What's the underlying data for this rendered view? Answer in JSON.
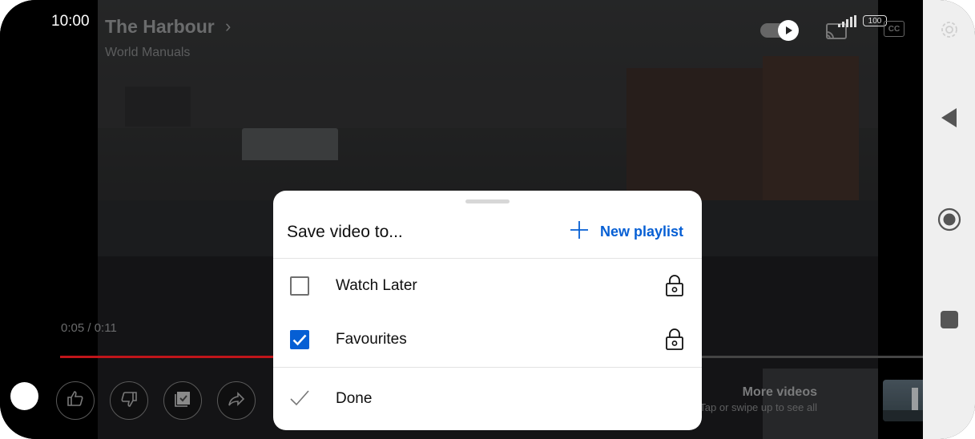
{
  "status_bar": {
    "time": "10:00",
    "battery": "100"
  },
  "video": {
    "title": "The Harbour",
    "channel": "World Manuals",
    "elapsed": "0:05",
    "duration": "0:11",
    "progress_fraction": 0.45,
    "autoplay_on": true
  },
  "more_videos": {
    "title": "More videos",
    "subtitle": "Tap or swipe up to see all"
  },
  "sheet": {
    "title": "Save video to...",
    "new_playlist_label": "New playlist",
    "playlists": [
      {
        "name": "Watch Later",
        "checked": false,
        "privacy_icon": "lock-icon"
      },
      {
        "name": "Favourites",
        "checked": true,
        "privacy_icon": "lock-icon"
      }
    ],
    "done_label": "Done"
  },
  "colors": {
    "accent": "#065fd4",
    "progress": "#c0151a",
    "sheet_bg": "#ffffff",
    "nav_bg": "#efefef"
  },
  "icons": {
    "nav": [
      "back-triangle-icon",
      "home-circle-icon",
      "recents-square-icon"
    ],
    "controls": [
      "like-icon",
      "dislike-icon",
      "save-icon",
      "share-icon"
    ]
  }
}
